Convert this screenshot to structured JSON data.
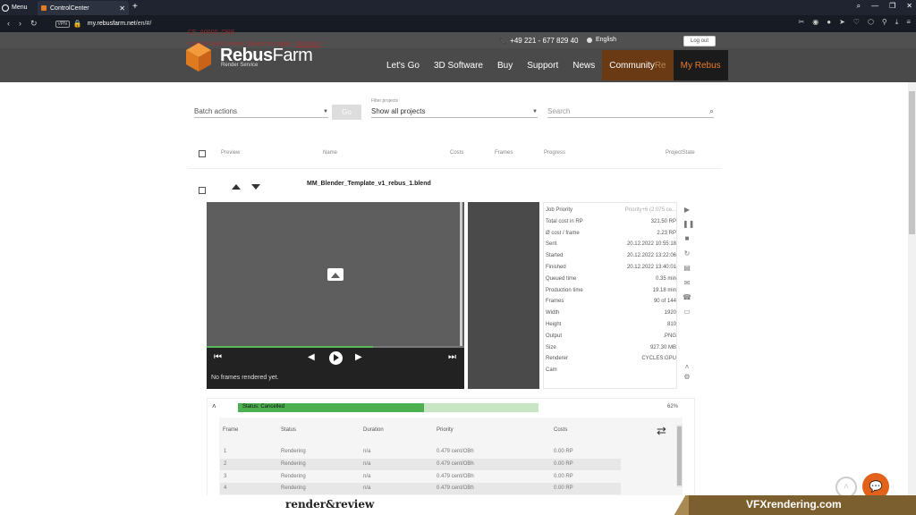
{
  "browser": {
    "menu_label": "Menu",
    "tab_title": "ControlCenter",
    "vpn_label": "VPN",
    "url_domain": "my.rebusfarm.net",
    "url_path": "/en/#/"
  },
  "header": {
    "error_title": "CF_A0000_ORE",
    "error_msg": "Cannot reach server, please try again.",
    "dismiss": "(dismiss)",
    "phone": "+49 221 - 677 829 40",
    "language": "English",
    "logout": "Log out",
    "logo_main": "Rebus",
    "logo_farm": "Farm",
    "logo_sub": "Render Service",
    "nav": [
      "Let's Go",
      "3D Software",
      "Buy",
      "Support",
      "News"
    ],
    "nav_community": "Community",
    "nav_community_tail": "Re",
    "nav_myrebus": "My Rebus"
  },
  "filters": {
    "batch_actions": "Batch actions",
    "go": "Go",
    "filter_label": "Filter projects",
    "filter_value": "Show all projects",
    "search_placeholder": "Search"
  },
  "table_header": {
    "preview": "Preview",
    "name": "Name",
    "costs": "Costs",
    "frames": "Frames",
    "progress": "Progress",
    "project_state": "ProjectState"
  },
  "project": {
    "name": "MM_Blender_Template_v1_rebus_1.blend",
    "no_frames": "No frames rendered yet.",
    "progress_fraction": 0.646,
    "details": [
      {
        "k": "Job Priority",
        "v": "Priority+6 (2.075 ce..."
      },
      {
        "k": "Total cost in RP",
        "v": "321.50 RP"
      },
      {
        "k": "Ø cost / frame",
        "v": "2.23 RP"
      },
      {
        "k": "Sent",
        "v": "20.12.2022 10:55:18"
      },
      {
        "k": "Started",
        "v": "20.12.2022 13:22:06"
      },
      {
        "k": "Finished",
        "v": "20.12.2022 13:40:01"
      },
      {
        "k": "Queued time",
        "v": "0.35 min"
      },
      {
        "k": "Production time",
        "v": "19.18 min"
      },
      {
        "k": "Frames",
        "v": "90 of 144"
      },
      {
        "k": "Width",
        "v": "1920"
      },
      {
        "k": "Height",
        "v": "810"
      },
      {
        "k": "Output",
        "v": ".PNG"
      },
      {
        "k": "Size",
        "v": "927.30 MB"
      },
      {
        "k": "Renderer",
        "v": "CYCLES:GPU"
      },
      {
        "k": "Cam",
        "v": ""
      }
    ],
    "status_text": "Status: Cancelled",
    "status_fraction": 0.62,
    "status_pct": "62%"
  },
  "frames_table": {
    "headers": [
      "Frame",
      "Status",
      "Duration",
      "Priority",
      "Costs"
    ],
    "rows": [
      [
        "1",
        "Rendering",
        "n/a",
        "0.479 cent/OBh",
        "0.00 RP"
      ],
      [
        "2",
        "Rendering",
        "n/a",
        "0.479 cent/OBh",
        "0.00 RP"
      ],
      [
        "3",
        "Rendering",
        "n/a",
        "0.479 cent/OBh",
        "0.00 RP"
      ],
      [
        "4",
        "Rendering",
        "n/a",
        "0.479 cent/OBh",
        "0.00 RP"
      ]
    ]
  },
  "banner": {
    "left": "render&review",
    "right": "VFXrendering.com"
  },
  "colors": {
    "accent_orange": "#e87c2b",
    "status_green": "#4caf50",
    "header_gray": "#4a4a4a"
  }
}
